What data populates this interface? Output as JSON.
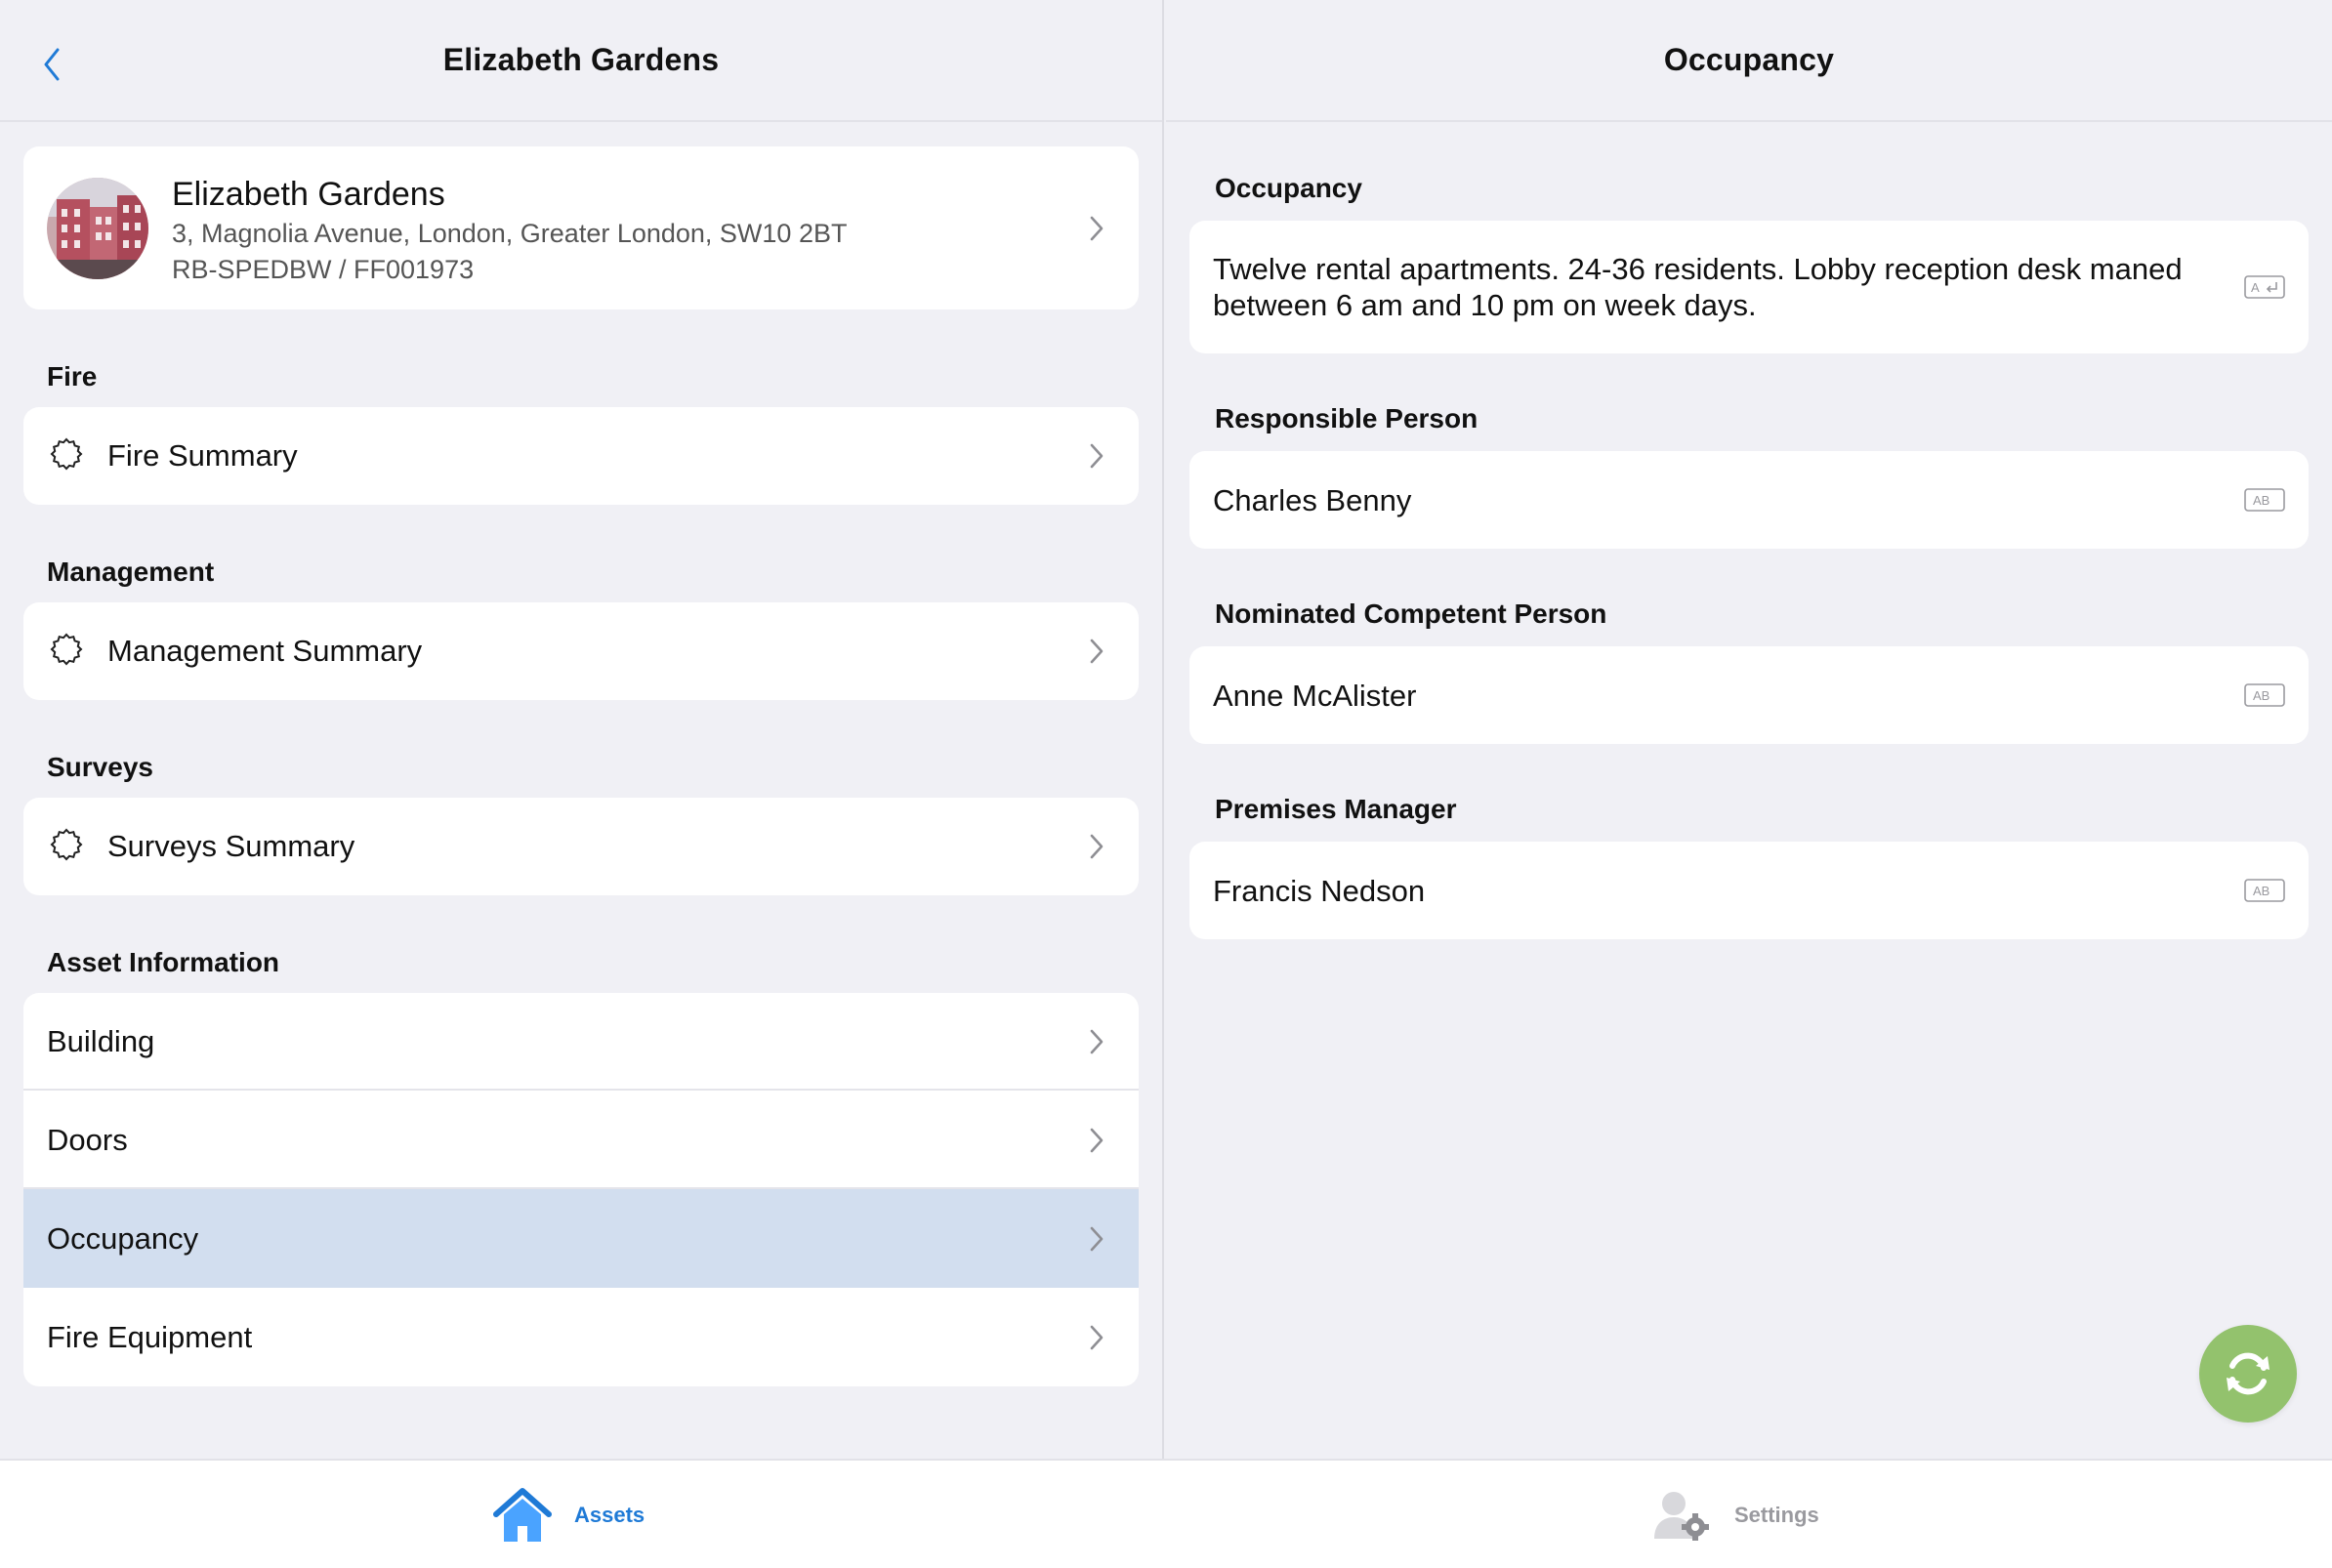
{
  "left": {
    "title": "Elizabeth Gardens",
    "asset": {
      "name": "Elizabeth Gardens",
      "address": "3, Magnolia Avenue, London, Greater London, SW10 2BT",
      "reference": "RB-SPEDBW / FF001973"
    },
    "sections": {
      "fire": {
        "header": "Fire",
        "item": "Fire Summary"
      },
      "management": {
        "header": "Management",
        "item": "Management Summary"
      },
      "surveys": {
        "header": "Surveys",
        "item": "Surveys Summary"
      },
      "asset_information": {
        "header": "Asset Information",
        "items": [
          "Building",
          "Doors",
          "Occupancy",
          "Fire Equipment"
        ],
        "selected": "Occupancy"
      }
    }
  },
  "right": {
    "title": "Occupancy",
    "fields": [
      {
        "label": "Occupancy",
        "value": "Twelve rental apartments. 24-36 residents. Lobby reception desk maned between 6 am and 10 pm on week days.",
        "keyboard_icon": "multiline-text-icon"
      },
      {
        "label": "Responsible Person",
        "value": "Charles Benny",
        "keyboard_icon": "text-field-icon"
      },
      {
        "label": "Nominated Competent Person",
        "value": "Anne McAlister",
        "keyboard_icon": "text-field-icon"
      },
      {
        "label": "Premises Manager",
        "value": "Francis Nedson",
        "keyboard_icon": "text-field-icon"
      }
    ],
    "sync_button_icon": "sync-icon"
  },
  "tabs": [
    {
      "label": "Assets",
      "icon": "house-icon",
      "active": true
    },
    {
      "label": "Settings",
      "icon": "user-gear-icon",
      "active": false
    }
  ],
  "colors": {
    "accent": "#1f7ad6",
    "selected_row": "#d2deef",
    "background": "#f0f0f5",
    "sync_button": "#93c26d"
  }
}
